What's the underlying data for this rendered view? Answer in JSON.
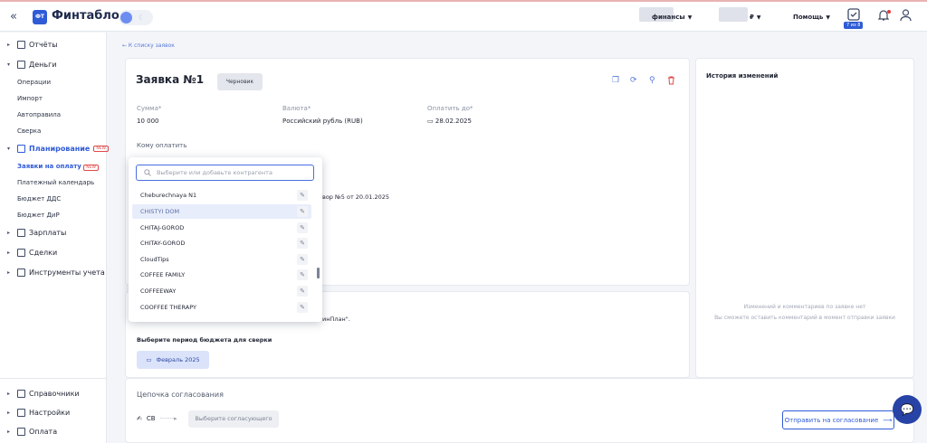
{
  "app": {
    "logo_short": "ФТ",
    "logo_text": "Финтабло",
    "collapse_icon": "«"
  },
  "topbar": {
    "finance_label": "финансы",
    "currency_label": "₽",
    "help_label": "Помощь",
    "tasks_badge": "7 из 8"
  },
  "sidebar": {
    "reports": "Отчёты",
    "money": "Деньги",
    "money_items": [
      "Операции",
      "Импорт",
      "Автоправила",
      "Сверка"
    ],
    "planning": "Планирование",
    "planning_new": "NEW",
    "planning_items": [
      "Заявки на оплату",
      "Платежный календарь",
      "Бюджет ДДС",
      "Бюджет ДиР"
    ],
    "salaries": "Зарплаты",
    "deals": "Сделки",
    "tools": "Инструменты учета",
    "references": "Справочники",
    "settings": "Настройки",
    "payment": "Оплата"
  },
  "main": {
    "back_link": "← К списку заявок",
    "title": "Заявка №1",
    "status": "Черновик",
    "sum_label": "Сумма*",
    "sum_value": "10 000",
    "currency_label": "Валюта*",
    "currency_value": "Российский рубль (RUB)",
    "pay_until_label": "Оплатить до*",
    "pay_until_value": "28.02.2025",
    "payee_label": "Кому оплатить",
    "contract_partial": "вор №5 от 20.01.2025",
    "link_partial": "инПлан\".",
    "period_label": "Выберите период бюджета для сверки",
    "period_value": "Февраль 2025",
    "chain_label": "Цепочка согласования",
    "chain_initials": "СВ",
    "approver_placeholder": "Выберите согласующего",
    "send_button": "Отправить на согласование"
  },
  "history": {
    "title": "История изменений",
    "empty_line1": "Изменений и комментариев по заявке нет",
    "empty_line2": "Вы сможете оставить комментарий в момент отправки заявки"
  },
  "dropdown": {
    "search_placeholder": "Выберите или добавьте контрагента",
    "items": [
      "Cheburechnaya N1",
      "CHISTYI DOM",
      "CHITAJ-GOROD",
      "CHITAY-GOROD",
      "CloudTips",
      "COFFEE FAMILY",
      "COFFEEWAY",
      "COOFFEE THERAPY"
    ],
    "selected_index": 1
  },
  "colors": {
    "accent": "#2f5bd6",
    "new_badge": "#e04848"
  }
}
